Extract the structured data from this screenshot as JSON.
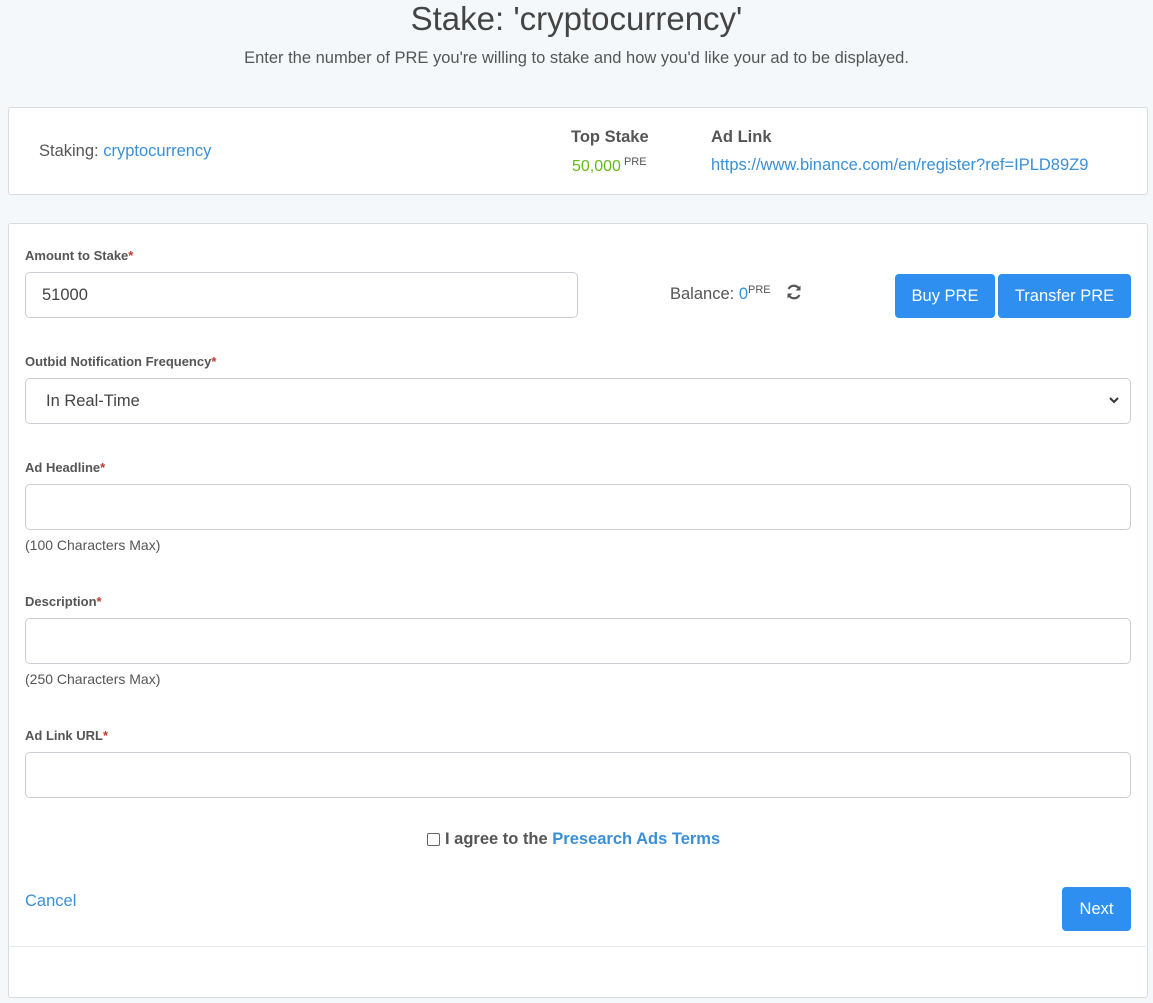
{
  "header": {
    "title": "Stake: 'cryptocurrency'",
    "subtitle": "Enter the number of PRE you're willing to stake and how you'd like your ad to be displayed."
  },
  "info": {
    "staking_label": "Staking:",
    "staking_keyword": "cryptocurrency",
    "top_stake_title": "Top Stake",
    "top_stake_value": "50,000",
    "top_stake_unit": "PRE",
    "ad_link_title": "Ad Link",
    "ad_link_value": "https://www.binance.com/en/register?ref=IPLD89Z9"
  },
  "form": {
    "amount_label": "Amount to Stake",
    "amount_value": "51000",
    "balance_label": "Balance:",
    "balance_value": "0",
    "balance_unit": "PRE",
    "buy_label": "Buy PRE",
    "transfer_label": "Transfer PRE",
    "frequency_label": "Outbid Notification Frequency",
    "frequency_value": "In Real-Time",
    "headline_label": "Ad Headline",
    "headline_value": "",
    "headline_helper": "(100 Characters Max)",
    "description_label": "Description",
    "description_value": "",
    "description_helper": "(250 Characters Max)",
    "url_label": "Ad Link URL",
    "url_value": "",
    "required_mark": "*",
    "agree_prefix": "I agree to the",
    "agree_link": "Presearch Ads Terms",
    "agree_checked": false,
    "cancel_label": "Cancel",
    "next_label": "Next"
  },
  "colors": {
    "accent": "#2e8ff0",
    "link": "#3b8fd6",
    "stake_green": "#66bb1a",
    "required_red": "#c0392b"
  },
  "icons": {
    "refresh": "refresh-icon",
    "chevron": "chevron-down-icon"
  }
}
